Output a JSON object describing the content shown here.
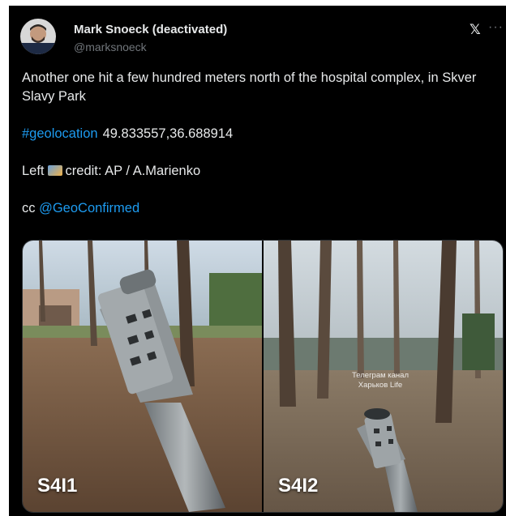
{
  "tweet": {
    "author_name": "Mark Snoeck (deactivated)",
    "author_handle": "@marksnoeck",
    "x_logo_glyph": "𝕏",
    "more_glyph": "···",
    "line1": "Another one hit a few hundred meters north of the hospital complex, in Skver Slavy Park",
    "hashtag": "#geolocation",
    "coordinates": "49.833557,36.688914",
    "credit_prefix": "Left",
    "credit_text": "credit: AP / A.Marienko",
    "cc_prefix": "cc",
    "mention": "@GeoConfirmed"
  },
  "media": {
    "left_label": "S4I1",
    "right_label": "S4I2",
    "watermark_line1": "Телеграм канал",
    "watermark_line2": "Харьков Life"
  },
  "colors": {
    "background": "#000000",
    "text": "#e7e9ea",
    "secondary": "#71767b",
    "link": "#1d9bf0"
  },
  "icons": {
    "camera": "camera-emoji-icon",
    "logo": "x-logo-icon",
    "more": "more-options-icon"
  }
}
